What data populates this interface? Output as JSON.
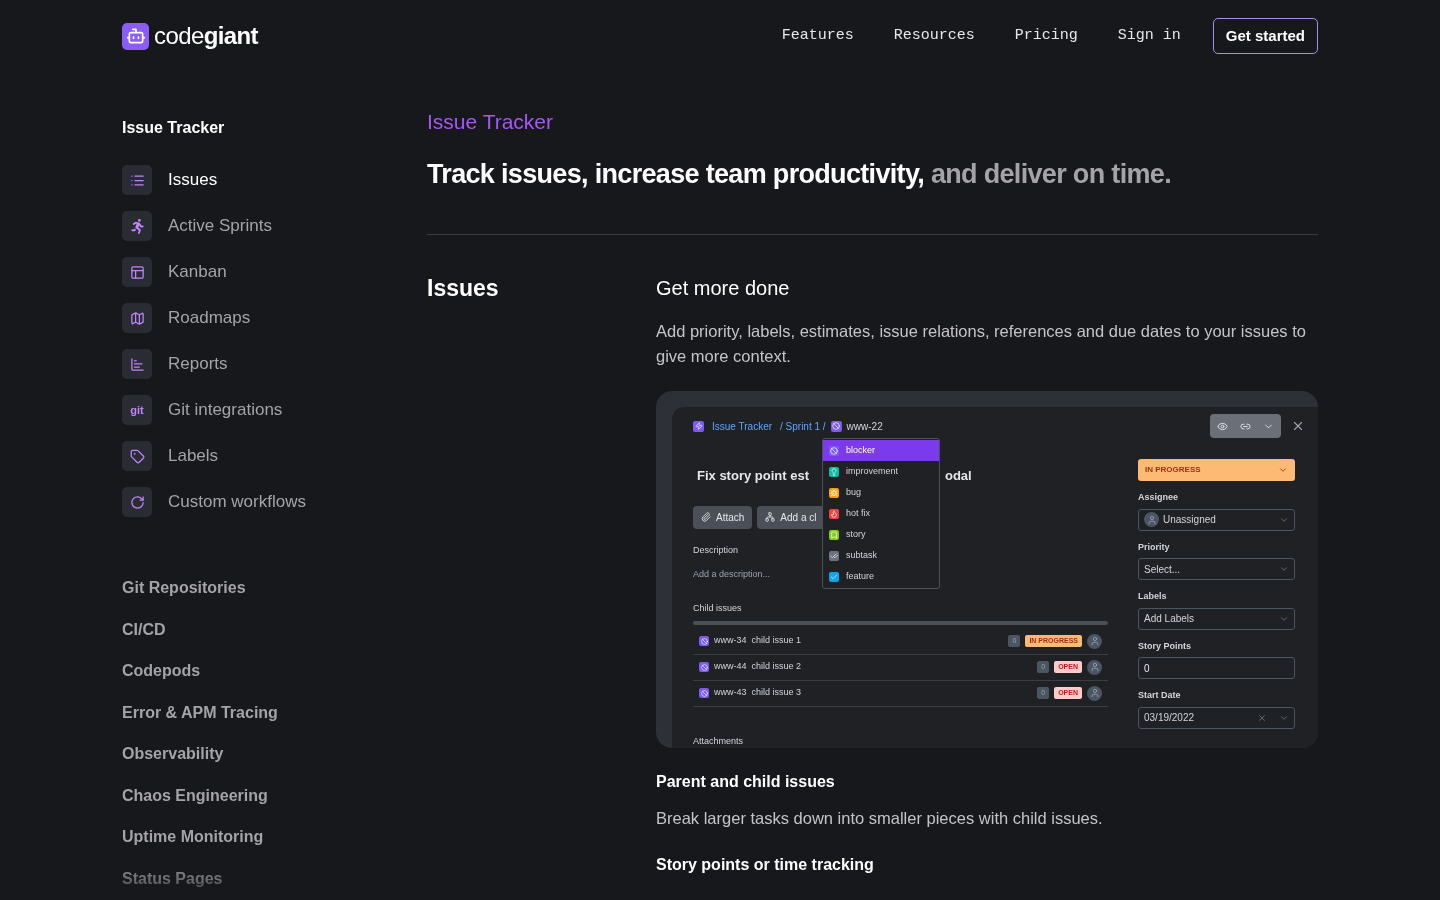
{
  "header": {
    "logo": "code**giant**",
    "nav": [
      "Features",
      "Resources",
      "Pricing",
      "Sign in"
    ],
    "cta": "Get started"
  },
  "sidebar": {
    "title": "Issue Tracker",
    "items": [
      {
        "label": "Issues",
        "selected": true
      },
      {
        "label": "Active Sprints",
        "selected": false
      },
      {
        "label": "Kanban",
        "selected": false
      },
      {
        "label": "Roadmaps",
        "selected": false
      },
      {
        "label": "Reports",
        "selected": false
      },
      {
        "label": "Git integrations",
        "selected": false,
        "icon_text": "git"
      },
      {
        "label": "Labels",
        "selected": false
      },
      {
        "label": "Custom workflows",
        "selected": false
      }
    ],
    "products": [
      "Git Repositories",
      "CI/CD",
      "Codepods",
      "Error & APM Tracing",
      "Observability",
      "Chaos Engineering",
      "Uptime Monitoring",
      "Status Pages"
    ]
  },
  "main": {
    "eyebrow": "Issue Tracker",
    "headline": "Track issues, increase team productivity,",
    "headline_muted": "and deliver on time.",
    "section_title": "Issues",
    "subtitle": "Get more done",
    "intro": "Add priority, labels, estimates, issue relations, references and due dates to your issues to give more context.",
    "mockup": {
      "breadcrumb": [
        "Issue Tracker",
        "/ Sprint 1 /",
        "www-22"
      ],
      "title_left": "Fix story point est",
      "title_right": "odal",
      "buttons": [
        "Attach",
        "Add a cl"
      ],
      "description_label": "Description",
      "description_placeholder": "Add a description...",
      "type_menu": [
        {
          "label": "blocker",
          "color": "#7c5cf0",
          "selected": true
        },
        {
          "label": "improvement",
          "color": "#14b8a6",
          "selected": false
        },
        {
          "label": "bug",
          "color": "#f59e0b",
          "selected": false
        },
        {
          "label": "hot fix",
          "color": "#ef4444",
          "selected": false
        },
        {
          "label": "story",
          "color": "#84cc16",
          "selected": false
        },
        {
          "label": "subtask",
          "color": "#6b7280",
          "selected": false
        },
        {
          "label": "feature",
          "color": "#0ea5e9",
          "selected": false
        }
      ],
      "child_issues_label": "Child issues",
      "child_issues": [
        {
          "id": "www-34",
          "title": "child issue 1",
          "count": "0",
          "status": "IN PROGRESS",
          "kind": "in_progress"
        },
        {
          "id": "www-44",
          "title": "child issue 2",
          "count": "0",
          "status": "OPEN",
          "kind": "open"
        },
        {
          "id": "www-43",
          "title": "child issue 3",
          "count": "0",
          "status": "OPEN",
          "kind": "open"
        }
      ],
      "attachments_label": "Attachments",
      "status": "IN PROGRESS",
      "fields": [
        {
          "label": "Assignee",
          "kind": "person",
          "value": "Unassigned"
        },
        {
          "label": "Priority",
          "kind": "select",
          "value": "Select..."
        },
        {
          "label": "Labels",
          "kind": "select",
          "value": "Add Labels"
        },
        {
          "label": "Story Points",
          "kind": "input",
          "value": "0"
        },
        {
          "label": "Start Date",
          "kind": "date",
          "value": "03/19/2022"
        }
      ]
    },
    "features": [
      {
        "title": "Parent and child issues",
        "text": "Break larger tasks down into smaller pieces with child issues."
      },
      {
        "title": "Story points or time tracking"
      }
    ]
  }
}
